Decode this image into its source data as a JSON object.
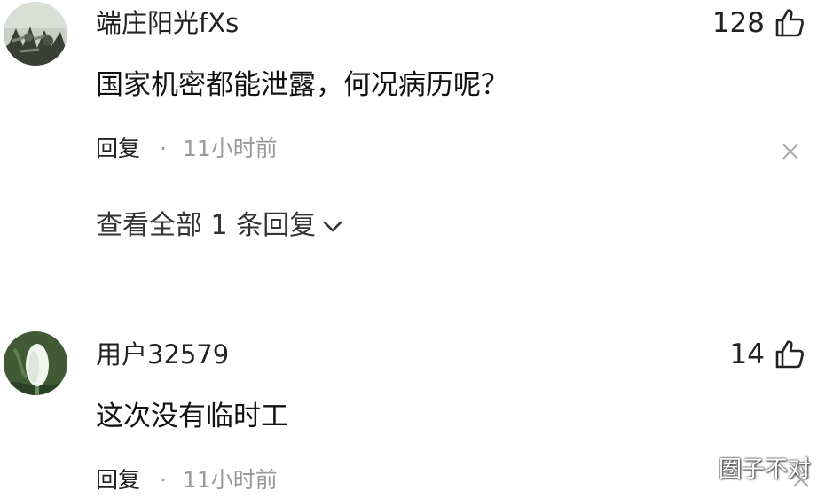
{
  "comments": [
    {
      "username": "端庄阳光fXs",
      "text": "国家机密都能泄露，何况病历呢？",
      "like_count": "128",
      "reply_label": "回复",
      "separator": "·",
      "time": "11小时前",
      "expand_replies_label": "查看全部 1 条回复",
      "avatar_icon": "dark-scenery-avatar"
    },
    {
      "username": "用户32579",
      "text": "这次没有临时工",
      "like_count": "14",
      "reply_label": "回复",
      "separator": "·",
      "time": "11小时前",
      "avatar_icon": "white-flower-avatar"
    }
  ],
  "icons": {
    "like": "thumbs-up-icon",
    "dismiss": "close-icon",
    "expand": "chevron-down-icon"
  },
  "watermark": "圈子不对",
  "colors": {
    "text_primary": "#1a1a1a",
    "text_secondary": "#999999",
    "background": "#ffffff"
  }
}
